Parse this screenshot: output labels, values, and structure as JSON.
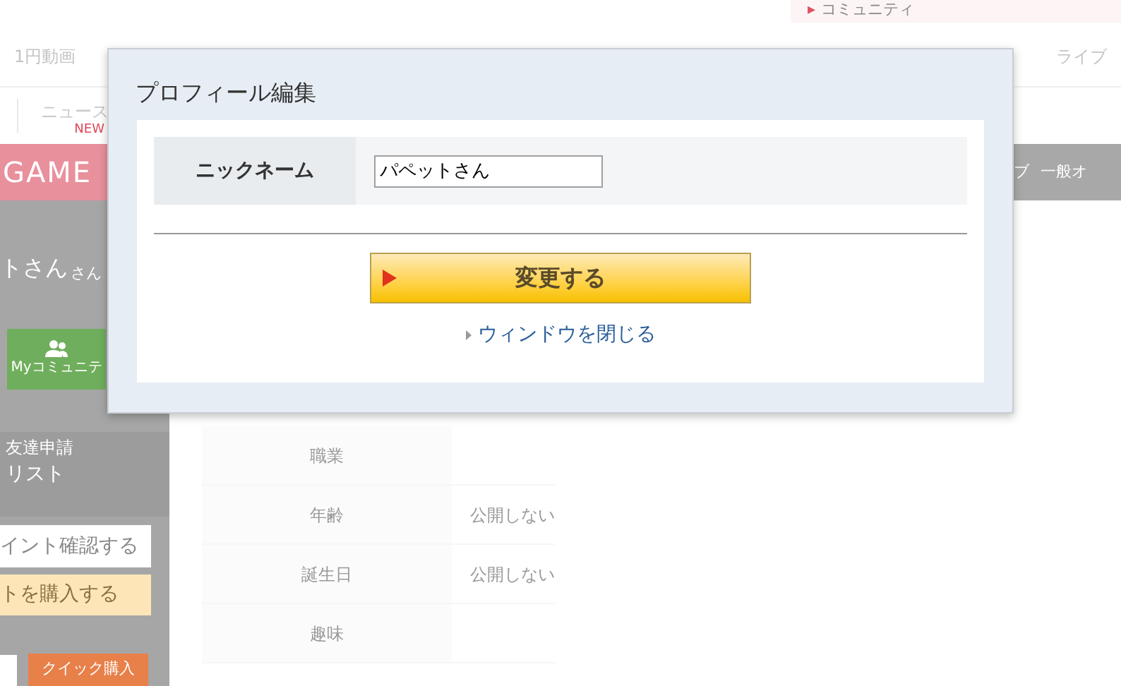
{
  "background": {
    "top_link_marker": "▸",
    "top_link": "コミュニティ",
    "nav": [
      "1円動画",
      "ライブ"
    ],
    "news": {
      "label": "ニュース",
      "badge": "NEW"
    },
    "banner": "GAME",
    "gray_bar": [
      "ブ",
      "一般オ"
    ],
    "sidebar": {
      "user_name": "トさん",
      "honorific": "さん",
      "community_button": "Myコミュニテ",
      "friend_request": "友達申請",
      "list": "リスト",
      "point_button": "イント確認する",
      "buy_button": "トを購入する",
      "quick_buy": "クイック購入"
    },
    "profile_rows": [
      {
        "label": "職業"
      },
      {
        "label": "年齢",
        "value": "公開しない"
      },
      {
        "label": "誕生日",
        "value": "公開しない"
      },
      {
        "label": "趣味"
      }
    ]
  },
  "dialog": {
    "title": "プロフィール編集",
    "field_label": "ニックネーム",
    "field_value": "パペットさん",
    "submit": "変更する",
    "close_link": "ウィンドウを閉じる"
  }
}
